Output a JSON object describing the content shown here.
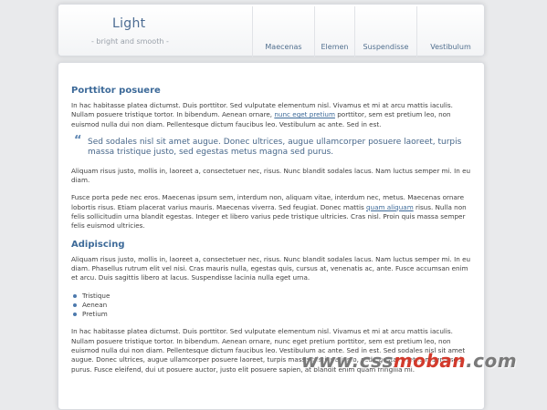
{
  "site": {
    "title": "Light",
    "tagline": "- bright and smooth -"
  },
  "nav": [
    {
      "label": "Maecenas"
    },
    {
      "label": "Elemen"
    },
    {
      "label": "Suspendisse"
    },
    {
      "label": "Vestibulum"
    }
  ],
  "content": {
    "heading1": "Porttitor posuere",
    "p1_text": "In hac habitasse platea dictumst. Duis porttitor. Sed vulputate elementum nisl. Vivamus et mi at arcu mattis iaculis. Nullam posuere tristique tortor. In bibendum. Aenean ornare, ",
    "p1_link": "nunc eget pretium",
    "p1_after": " porttitor, sem est pretium leo, non euismod nulla dui non diam. Pellentesque dictum faucibus leo. Vestibulum ac ante. Sed in est.",
    "quote": "Sed sodales nisl sit amet augue. Donec ultrices, augue ullamcorper posuere laoreet, turpis massa tristique justo, sed egestas metus magna sed purus.",
    "p2": "Aliquam risus justo, mollis in, laoreet a, consectetuer nec, risus. Nunc blandit sodales lacus. Nam luctus semper mi. In eu diam.",
    "p3_text": "Fusce porta pede nec eros. Maecenas ipsum sem, interdum non, aliquam vitae, interdum nec, metus. Maecenas ornare lobortis risus. Etiam placerat varius mauris. Maecenas viverra. Sed feugiat. Donec mattis ",
    "p3_link": "quam aliquam",
    "p3_after": " risus. Nulla non felis sollicitudin urna blandit egestas. Integer et libero varius pede tristique ultricies. Cras nisl. Proin quis massa semper felis euismod ultricies.",
    "heading2": "Adipiscing",
    "p4": "Aliquam risus justo, mollis in, laoreet a, consectetuer nec, risus. Nunc blandit sodales lacus. Nam luctus semper mi. In eu diam. Phasellus rutrum elit vel nisi. Cras mauris nulla, egestas quis, cursus at, venenatis ac, ante. Fusce accumsan enim et arcu. Duis sagittis libero at lacus. Suspendisse lacinia nulla eget urna.",
    "bullets": [
      "Tristique",
      "Aenean",
      "Pretium"
    ],
    "p5": "In hac habitasse platea dictumst. Duis porttitor. Sed vulputate elementum nisl. Vivamus et mi at arcu mattis iaculis. Nullam posuere tristique tortor. In bibendum. Aenean ornare, nunc eget pretium porttitor, sem est pretium leo, non euismod nulla dui non diam. Pellentesque dictum faucibus leo. Vestibulum ac ante. Sed in est. Sed sodales nisl sit amet augue. Donec ultrices, augue ullamcorper posuere laoreet, turpis massa tristique justo, sed egestas metus magna sed purus. Fusce eleifend, dui ut posuere auctor, justo elit posuere sapien, at blandit enim quam fringilla mi."
  },
  "watermark": {
    "part1": "www.css",
    "part2": "moban",
    "part3": ".com"
  }
}
